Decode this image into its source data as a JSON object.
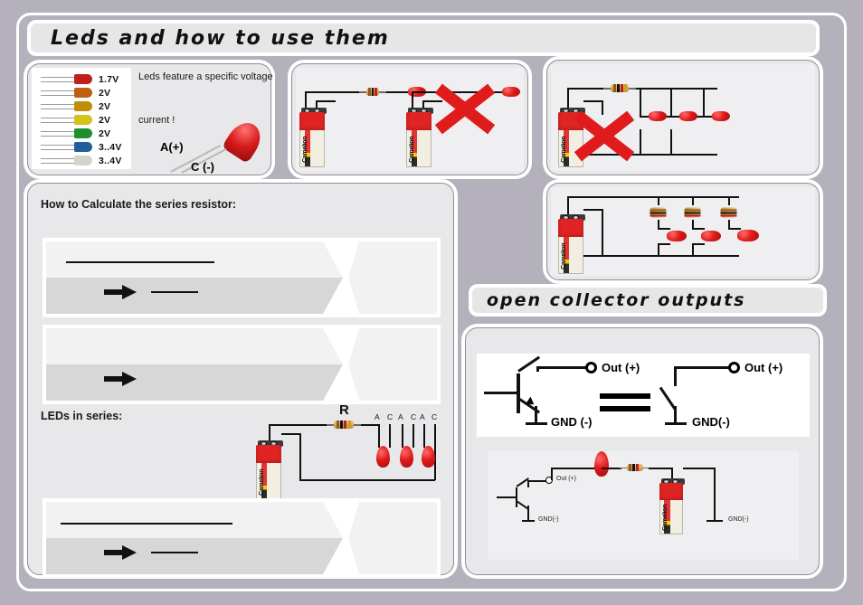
{
  "document": {
    "title": "Leds and how to use them",
    "background_color": "#b4b1bd"
  },
  "sections": {
    "main_title": "Leds and how to use them",
    "open_collector_title": "open collector outputs",
    "calc_heading": "How to Calculate the series resistor:",
    "series_heading": "LEDs in series:"
  },
  "led_table": {
    "note_top": "Leds feature a specific voltage",
    "note_bottom": "current !",
    "anode_label": "A(+)",
    "cathode_label": "C (-)",
    "rows": [
      {
        "color_name": "red",
        "color": "#c0201c",
        "voltage": "1.7V"
      },
      {
        "color_name": "orange",
        "color": "#c0600f",
        "voltage": "2V"
      },
      {
        "color_name": "amber",
        "color": "#c08d0a",
        "voltage": "2V"
      },
      {
        "color_name": "yellow",
        "color": "#d4c319",
        "voltage": "2V"
      },
      {
        "color_name": "green",
        "color": "#1f8f2e",
        "voltage": "2V"
      },
      {
        "color_name": "blue",
        "color": "#1f5f9c",
        "voltage": "3..4V"
      },
      {
        "color_name": "white",
        "color": "#d4d4cc",
        "voltage": "3..4V"
      }
    ]
  },
  "circuits": {
    "single_led_correct": {
      "caption": "",
      "marked_wrong": false
    },
    "single_led_no_resistor": {
      "caption": "",
      "marked_wrong": true
    },
    "parallel_shared_resistor": {
      "caption": "",
      "marked_wrong": true
    },
    "parallel_own_resistors": {
      "caption": "",
      "marked_wrong": false
    },
    "series_leds": {
      "resistor_label": "R",
      "pin_labels": [
        "A",
        "C",
        "A",
        "C",
        "A",
        "C"
      ]
    }
  },
  "open_collector": {
    "transistor_out_label": "Out (+)",
    "transistor_gnd_label": "GND (-)",
    "switch_out_label": "Out (+)",
    "switch_gnd_label": "GND(-)",
    "example_out_label": "Out (+)",
    "example_gnd_left_label": "GND(-)",
    "example_gnd_right_label": "GND(-)"
  },
  "formula_banners": [
    {
      "id": "formula-1",
      "top_rule": true,
      "arrow": true,
      "arrow_rule": true
    },
    {
      "id": "formula-2",
      "top_rule": false,
      "arrow": true,
      "arrow_rule": false
    },
    {
      "id": "formula-3",
      "top_rule": true,
      "arrow": true,
      "arrow_rule": true
    }
  ]
}
